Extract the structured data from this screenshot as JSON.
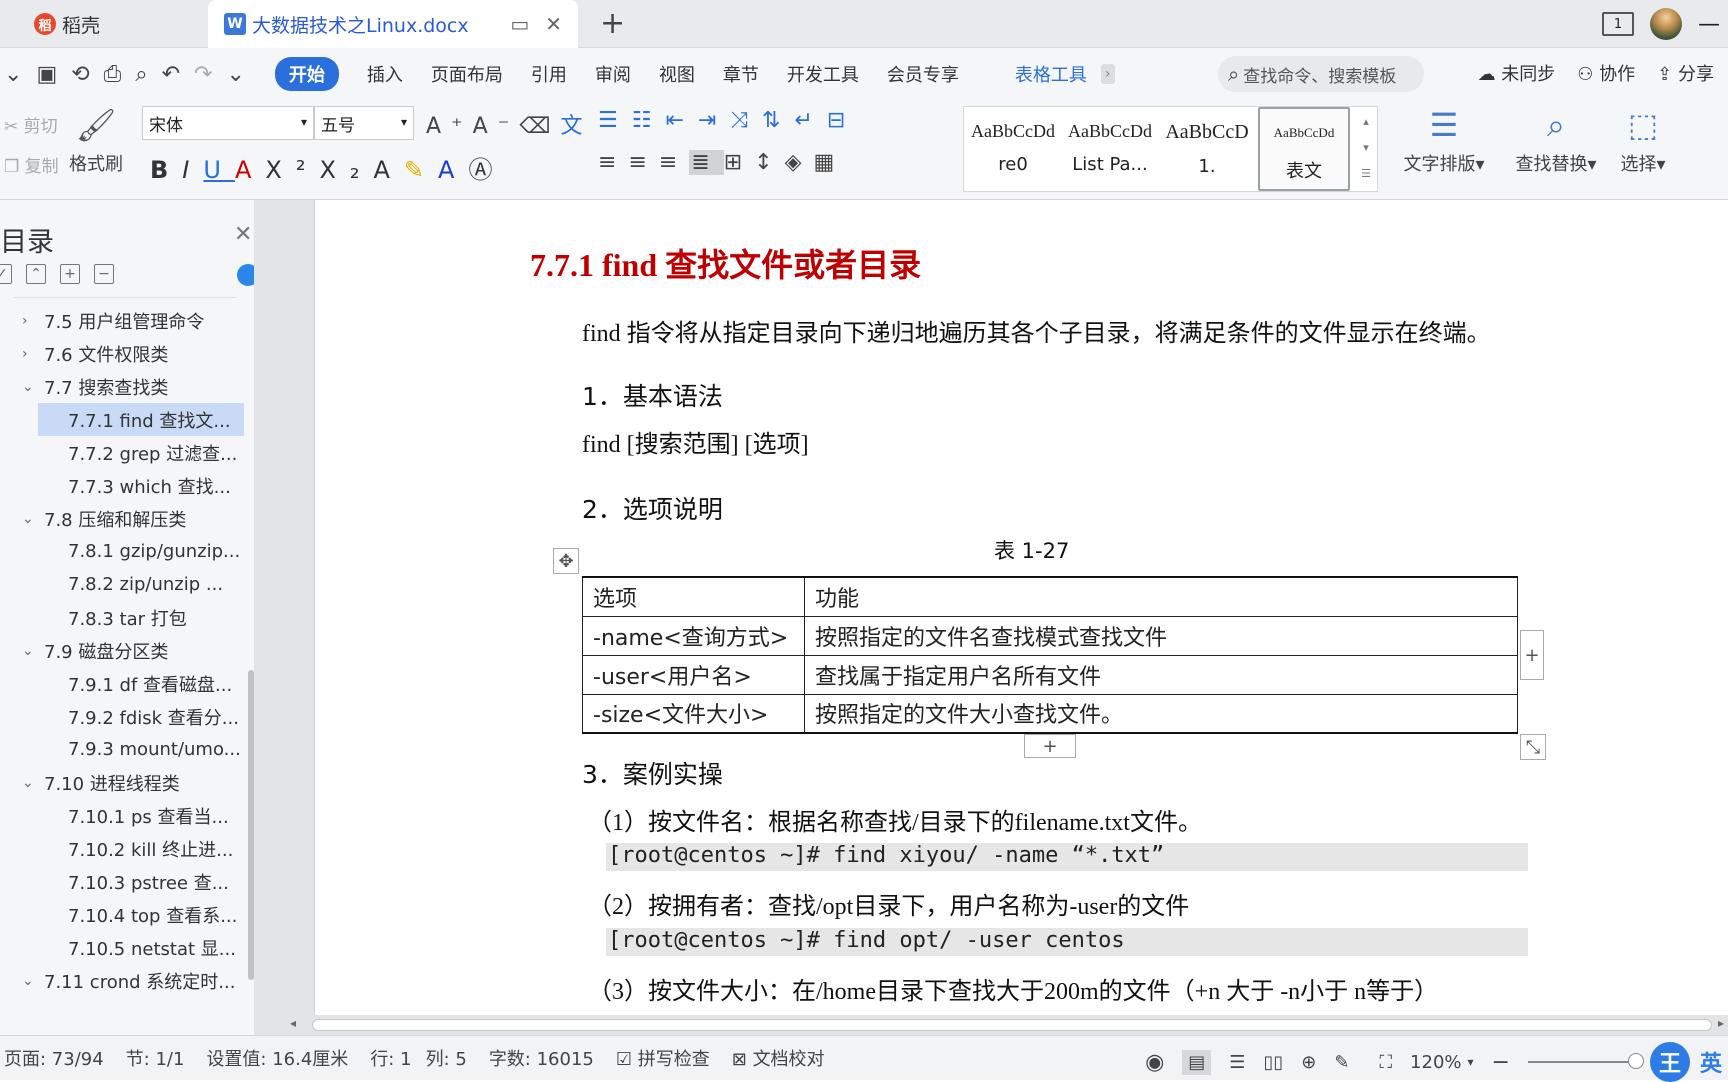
{
  "tabs": {
    "docer": "稻壳",
    "document": "大数据技术之Linux.docx",
    "page_count_icon": "1"
  },
  "menu": {
    "items": [
      "开始",
      "插入",
      "页面布局",
      "引用",
      "审阅",
      "视图",
      "章节",
      "开发工具",
      "会员专享"
    ],
    "table_tools": "表格工具",
    "search_placeholder": "查找命令、搜索模板",
    "sync": "未同步",
    "collaborate": "协作",
    "share": "分享"
  },
  "ribbon": {
    "cut": "剪切",
    "copy": "复制",
    "format_painter": "格式刷",
    "font_name": "宋体",
    "font_size": "五号",
    "styles": [
      {
        "sample": "AaBbCcDd",
        "name": "re0"
      },
      {
        "sample": "AaBbCcDd",
        "name": "List Pa..."
      },
      {
        "sample": "AaBbCcD",
        "name": "1."
      },
      {
        "sample": "AaBbCcDd",
        "name": "表文"
      }
    ],
    "text_layout": "文字排版",
    "find_replace": "查找替换",
    "select": "选择"
  },
  "sidebar": {
    "title": "目录",
    "items": [
      {
        "label": "7.5  用户组管理命令",
        "level": 1,
        "chevron": ">"
      },
      {
        "label": "7.6  文件权限类",
        "level": 1,
        "chevron": ">"
      },
      {
        "label": "7.7  搜索查找类",
        "level": 1,
        "chevron": "v"
      },
      {
        "label": "7.7.1 find  查找文...",
        "level": 2,
        "selected": true
      },
      {
        "label": "7.7.2 grep  过滤查...",
        "level": 2
      },
      {
        "label": "7.7.3 which  查找...",
        "level": 2
      },
      {
        "label": "7.8  压缩和解压类",
        "level": 1,
        "chevron": "v"
      },
      {
        "label": "7.8.1 gzip/gunzip...",
        "level": 2
      },
      {
        "label": "7.8.2 zip/unzip  ...",
        "level": 2
      },
      {
        "label": "7.8.3 tar  打包",
        "level": 2
      },
      {
        "label": "7.9  磁盘分区类",
        "level": 1,
        "chevron": "v"
      },
      {
        "label": "7.9.1 df  查看磁盘...",
        "level": 2
      },
      {
        "label": "7.9.2 fdisk  查看分...",
        "level": 2
      },
      {
        "label": "7.9.3 mount/umo...",
        "level": 2
      },
      {
        "label": "7.10  进程线程类",
        "level": 1,
        "chevron": "v"
      },
      {
        "label": "7.10.1 ps  查看当...",
        "level": 2
      },
      {
        "label": "7.10.2 kill  终止进...",
        "level": 2
      },
      {
        "label": "7.10.3 pstree  查...",
        "level": 2
      },
      {
        "label": "7.10.4 top  查看系...",
        "level": 2
      },
      {
        "label": "7.10.5 netstat  显...",
        "level": 2
      },
      {
        "label": "7.11 crond  系统定时...",
        "level": 1,
        "chevron": "v"
      }
    ]
  },
  "document": {
    "heading": "7.7.1 find  查找文件或者目录",
    "intro": "find 指令将从指定目录向下递归地遍历其各个子目录，将满足条件的文件显示在终端。",
    "section1": "1．基本语法",
    "syntax": "find [搜索范围] [选项]",
    "section2": "2．选项说明",
    "table_caption": "表 1-27",
    "table": {
      "headers": [
        "选项",
        "功能"
      ],
      "rows": [
        [
          "-name<查询方式>",
          "按照指定的文件名查找模式查找文件"
        ],
        [
          "-user<用户名>",
          "查找属于指定用户名所有文件"
        ],
        [
          "-size<文件大小>",
          "按照指定的文件大小查找文件。"
        ]
      ]
    },
    "section3": "3．案例实操",
    "case1": "（1）按文件名：根据名称查找/目录下的filename.txt文件。",
    "code1": "[root@centos ~]# find xiyou/ -name “*.txt”",
    "case2": "（2）按拥有者：查找/opt目录下，用户名称为-user的文件",
    "code2": "[root@centos ~]# find opt/ -user centos",
    "case3": "（3）按文件大小：在/home目录下查找大于200m的文件（+n  大于   -n小于     n等于）"
  },
  "status": {
    "page": "页面: 73/94",
    "section": "节: 1/1",
    "setting": "设置值: 16.4厘米",
    "row": "行: 1",
    "col": "列: 5",
    "word_count": "字数: 16015",
    "spell_check": "拼写检查",
    "proofread": "文档校对",
    "zoom": "120%",
    "ime": "英"
  }
}
